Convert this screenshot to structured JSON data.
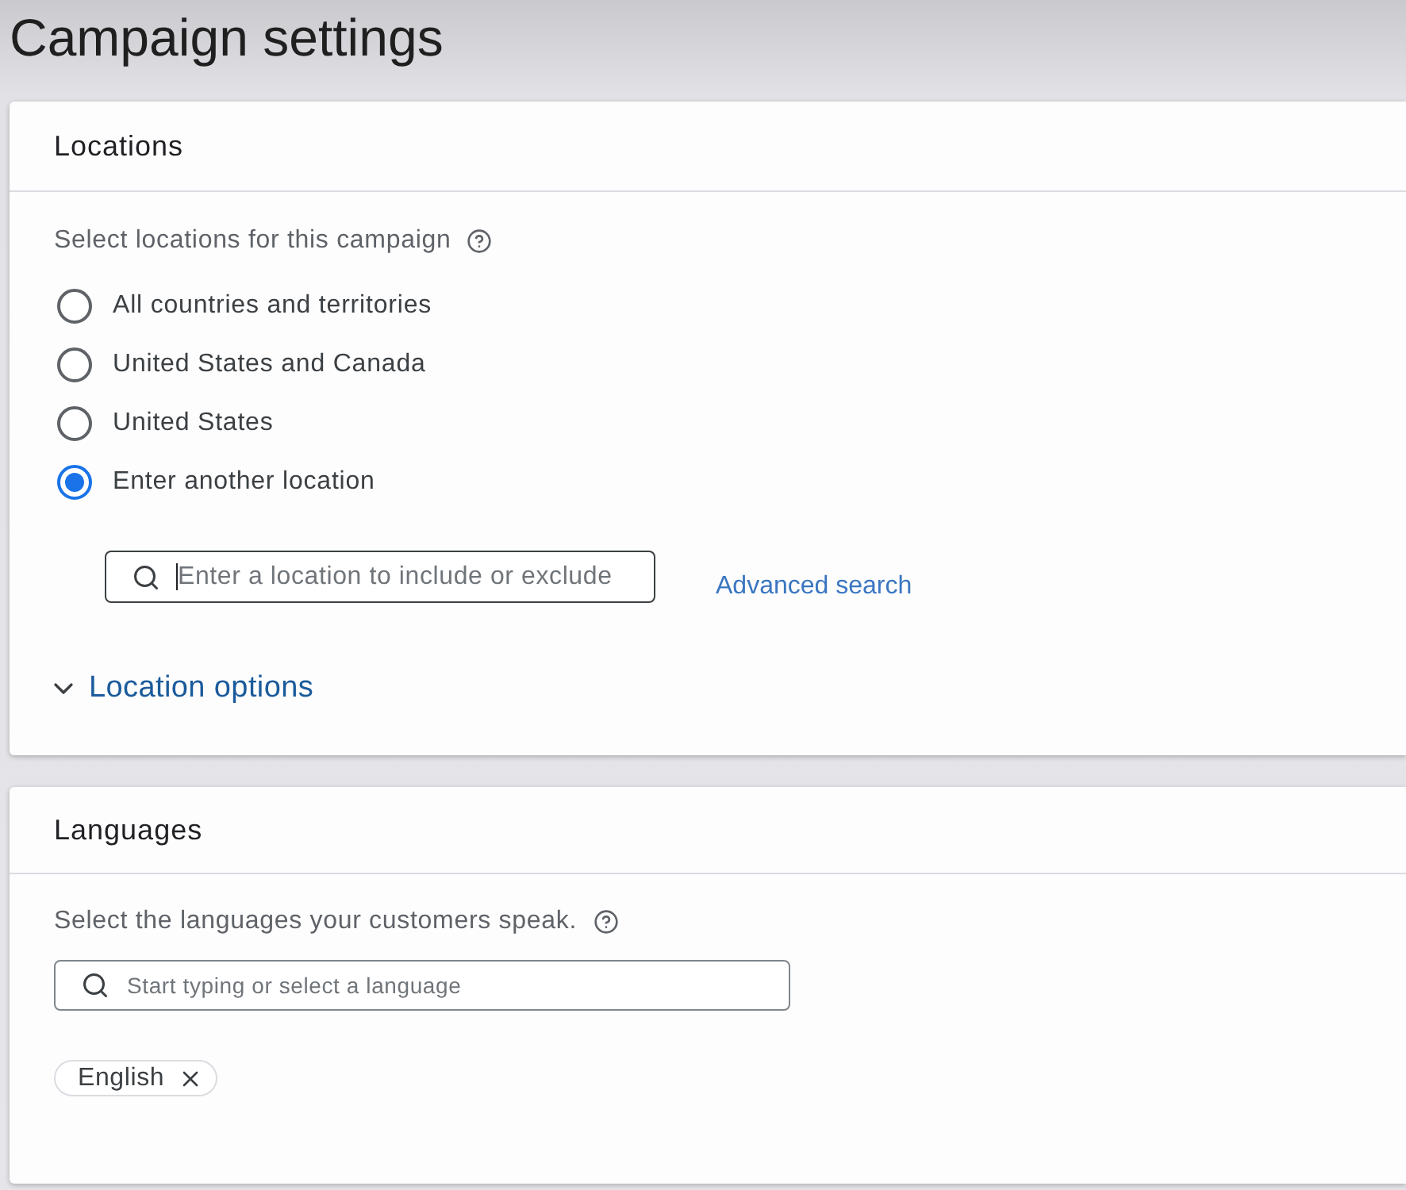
{
  "page": {
    "title": "Campaign settings"
  },
  "locations": {
    "title": "Locations",
    "prompt": "Select locations for this campaign",
    "options": [
      {
        "label": "All countries and territories",
        "selected": false
      },
      {
        "label": "United States and Canada",
        "selected": false
      },
      {
        "label": "United States",
        "selected": false
      },
      {
        "label": "Enter another location",
        "selected": true
      }
    ],
    "search": {
      "placeholder": "Enter a location to include or exclude",
      "focused": true
    },
    "advanced_search": "Advanced search",
    "location_options": {
      "label": "Location options",
      "expanded": false
    }
  },
  "languages": {
    "title": "Languages",
    "prompt": "Select the languages your customers speak.",
    "search": {
      "placeholder": "Start typing or select a language",
      "focused": false
    },
    "chips": [
      {
        "label": "English"
      }
    ]
  }
}
